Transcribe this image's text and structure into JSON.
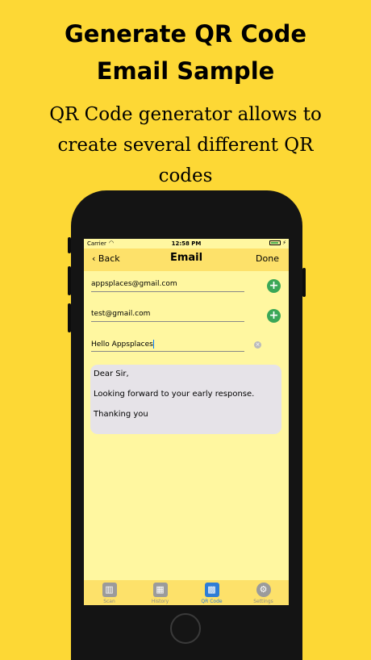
{
  "promo": {
    "title_line1": "Generate QR Code",
    "title_line2": "Email Sample",
    "subtitle_line1": "QR Code generator allows to",
    "subtitle_line2": "create several different QR",
    "subtitle_line3": "codes"
  },
  "status_bar": {
    "carrier": "Carrier",
    "time": "12:58 PM"
  },
  "nav": {
    "back_label": "Back",
    "title": "Email",
    "done_label": "Done"
  },
  "form": {
    "to_value": "appsplaces@gmail.com",
    "cc_value": "test@gmail.com",
    "subject_value": "Hello Appsplaces",
    "body_lines": [
      "Dear Sir,",
      "Looking forward to your early response.",
      "Thanking you"
    ]
  },
  "tabs": [
    {
      "label": "Scan",
      "icon": "barcode-icon"
    },
    {
      "label": "History",
      "icon": "calendar-icon"
    },
    {
      "label": "QR Code",
      "icon": "qr-code-icon",
      "active": true
    },
    {
      "label": "Settings",
      "icon": "gear-icon"
    }
  ],
  "colors": {
    "background": "#fdd835",
    "screen": "#fff7a0",
    "bar": "#fde16a",
    "accent": "#2f7dd6",
    "plus": "#3aa757"
  }
}
